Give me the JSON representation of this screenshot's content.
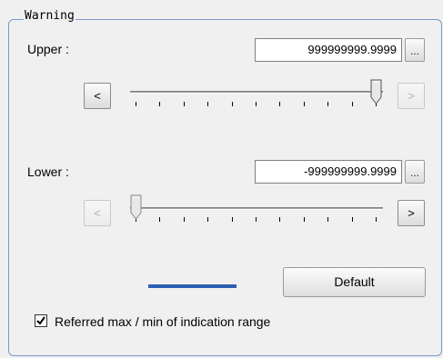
{
  "group_title": "Warning",
  "upper": {
    "label": "Upper :",
    "value": "999999999.9999",
    "browse_label": "...",
    "decrease_label": "<",
    "increase_label": ">",
    "slider_level": 1.0,
    "decrease_enabled": true,
    "increase_enabled": false
  },
  "lower": {
    "label": "Lower :",
    "value": "-999999999.9999",
    "browse_label": "...",
    "decrease_label": "<",
    "increase_label": ">",
    "slider_level": 0.0,
    "decrease_enabled": false,
    "increase_enabled": true
  },
  "color_indicator": "#2d5fb4",
  "default_button": "Default",
  "referred_checkbox": {
    "checked": true,
    "label": "Referred max / min of indication range"
  }
}
